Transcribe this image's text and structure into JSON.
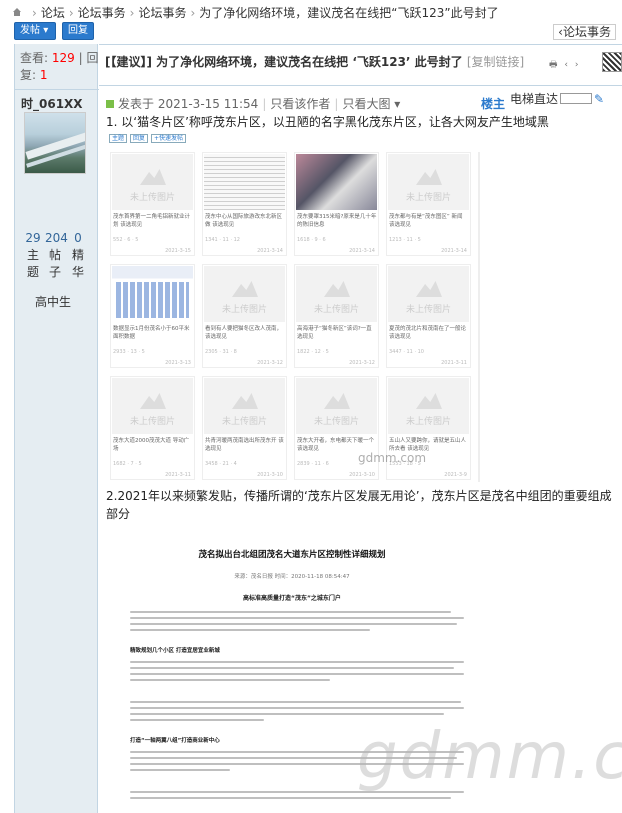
{
  "breadcrumb": {
    "items": [
      "论坛",
      "论坛事务",
      "论坛事务",
      "为了净化网络环境，建议茂名在线把“飞跃123”此号封了"
    ]
  },
  "toolbar": {
    "post_label": "发帖",
    "reply_label": "回复",
    "forum_tag": "论坛事务"
  },
  "thread_stats": {
    "views_label": "查看:",
    "views": "129",
    "replies_label": "回复:",
    "replies": "1",
    "separator": "|"
  },
  "thread": {
    "title": "[【建议】] 为了净化网络环境，建议茂名在线把 ‘飞跃123’ 此号封了",
    "copy_link": "[复制链接]"
  },
  "author": {
    "name": "时_061XX",
    "threads_count": "29",
    "threads_label": "主题",
    "posts_count": "204",
    "posts_label": "帖子",
    "digest_count": "0",
    "digest_label": "精华",
    "rank": "高中生"
  },
  "post": {
    "posted_text": "发表于 2021-3-15 11:54",
    "only_author": "只看该作者",
    "only_big_image": "只看大图",
    "floor_label": "楼主",
    "elevator_label": "电梯直达",
    "para1": "1. 以‘猫冬片区’称呼茂东片区，以丑陋的名字黑化茂东片区，让各大网友产生地域黑",
    "para2": "2.2021年以来频繁发贴，传播所谓的‘茂东片区发展无用论’，茂东片区是茂名中组团的重要组成部分"
  },
  "screenshot": {
    "tabs": [
      "主题",
      "回复",
      "+快速发帖"
    ],
    "placeholder_text": "未上传图片",
    "cards": [
      {
        "caption": "茂东首界第一二角毛铝新就业计划 该选现见",
        "meta": "552 · 6 · 5",
        "date": "2021-3-15"
      },
      {
        "caption": "茂东中心从国际旅游改东北新区做 该选现见",
        "meta": "1341 · 11 · 12",
        "date": "2021-3-14"
      },
      {
        "caption": "茂东要罩315米暗?原来是几十年的陈旧信息",
        "meta": "1618 · 9 · 6",
        "date": "2021-3-14"
      },
      {
        "caption": "茂东都与有是“茂东图区” 新闻 该选现见",
        "meta": "1213 · 11 · 5",
        "date": "2021-3-14"
      },
      {
        "caption": "数据显示1月份茂名小于60平米面积数据",
        "meta": "2933 · 13 · 5",
        "date": "2021-3-13"
      },
      {
        "caption": "看到有人要把猫冬区改人茂南，该选现见",
        "meta": "2305 · 31 · 8",
        "date": "2021-3-12"
      },
      {
        "caption": "高海港子“猫冬新区”该词?一直选现见",
        "meta": "1822 · 12 · 5",
        "date": "2021-3-12"
      },
      {
        "caption": "夏茂的茂北片和茂南在了一般论 该选现见",
        "meta": "3447 · 11 · 10",
        "date": "2021-3-11"
      },
      {
        "caption": "茂东大道2000茂茂大道 导动广场",
        "meta": "1682 · 7 · 5",
        "date": "2021-3-11"
      },
      {
        "caption": "共青河暖两茂南选出所茂东开 该选现见",
        "meta": "3458 · 21 · 4",
        "date": "2021-3-10"
      },
      {
        "caption": "茂东大开者，东电都天下暖一个 该选现见",
        "meta": "2839 · 11 · 6",
        "date": "2021-3-10"
      },
      {
        "caption": "五山人又要跨你，请就是五山人所去看 该选现见",
        "meta": "1553 · 18 · 5",
        "date": "2021-3-9"
      }
    ]
  },
  "article": {
    "title": "茂名拟出台北组团茂名大道东片区控制性详细规划",
    "source": "来源：茂名日报    时间：2020-11-18 08:54:47",
    "heading": "高标准高质量打造“茂东”之城东门户",
    "section1": "精致规划几个小区 打造宜居宜业新城",
    "section2": "打造“一轴两翼八组”打造商业新中心"
  },
  "watermarks": {
    "small": "gdmm.com",
    "large": "gdmm.com"
  }
}
